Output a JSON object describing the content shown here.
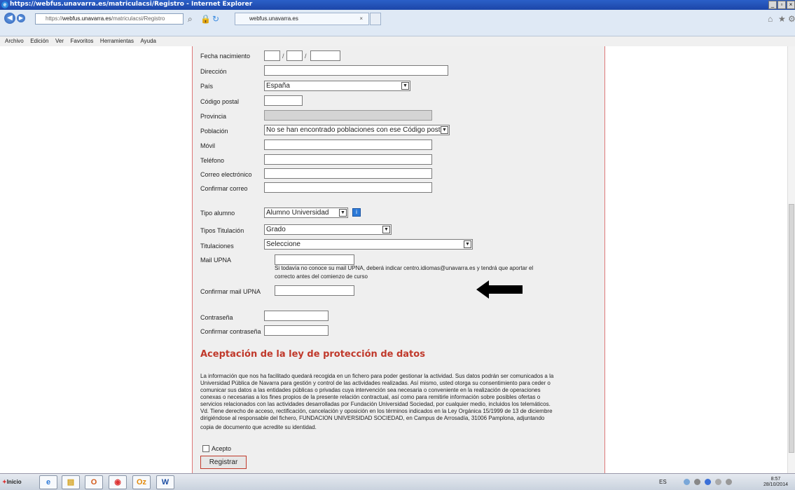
{
  "window": {
    "title": "https://webfus.unavarra.es/matriculacsi/Registro - Internet Explorer",
    "ie_icon": "e"
  },
  "nav": {
    "address_prefix": "https://",
    "address_domain": "webfus.unavarra.es",
    "address_path": "/matriculacsi/Registro",
    "tab_label": "webfus.unavarra.es",
    "tab_close": "×"
  },
  "menu": {
    "items": [
      "Archivo",
      "Edición",
      "Ver",
      "Favoritos",
      "Herramientas",
      "Ayuda"
    ]
  },
  "form": {
    "fecha_nacimiento": "Fecha nacimiento",
    "date_sep": "/",
    "direccion": "Dirección",
    "pais": "País",
    "pais_value": "España",
    "codigo_postal": "Código postal",
    "provincia": "Provincia",
    "poblacion": "Población",
    "poblacion_value": "No se han encontrado poblaciones con ese Código postal",
    "movil": "Móvil",
    "telefono": "Teléfono",
    "correo": "Correo electrónico",
    "confirmar_correo": "Confirmar correo",
    "tipo_alumno": "Tipo alumno",
    "tipo_alumno_value": "Alumno Universidad",
    "tipos_titulacion": "Tipos Titulación",
    "tipos_titulacion_value": "Grado",
    "titulaciones": "Titulaciones",
    "titulaciones_value": "Seleccione",
    "mail_upna": "Mail UPNA",
    "mail_note_1": "Si todavía no conoce su mail UPNA, deberá indicar centro.idiomas@unavarra.es y tendrá que aportar el",
    "mail_note_2": "correcto antes del comienzo de curso",
    "confirmar_mail": "Confirmar mail UPNA",
    "contrasena": "Contraseña",
    "confirmar_contrasena": "Confirmar contraseña"
  },
  "privacy": {
    "title": "Aceptación de la ley de protección de datos",
    "lines": [
      "La información que nos ha facilitado quedará recogida en un fichero para poder gestionar la actividad. Sus datos podrán ser comunicados a la",
      "Universidad Pública de Navarra para gestión y control de las actividades realizadas. Así mismo, usted otorga su consentimiento para ceder o",
      "comunicar sus datos a las entidades públicas o privadas cuya intervención sea necesaria o conveniente en la realización de operaciones",
      "conexas o necesarias a los fines propios de la presente relación contractual, así como para remitirle información sobre posibles ofertas o",
      "servicios relacionados con las actividades desarrolladas por Fundación Universidad Sociedad, por cualquier medio, incluidos los telemáticos.",
      "Vd. Tiene derecho de acceso, rectificación, cancelación y oposición en los términos indicados en la Ley Orgánica 15/1999 de 13 de diciembre",
      "dirigiéndose al responsable del fichero, FUNDACION UNIVERSIDAD SOCIEDAD, en Campus de Arrosadía, 31006 Pamplona, adjuntando",
      "copia de documento que acredite su identidad."
    ],
    "accept_label": "Acepto",
    "register_label": "Registrar"
  },
  "taskbar": {
    "start_label": "Inicio",
    "apps": [
      "e",
      "▤",
      "O",
      "◉",
      "Oz",
      "W"
    ],
    "lang": "ES",
    "time": "8:57",
    "date": "28/10/2014"
  },
  "colors": {
    "accent_red": "#c0392b",
    "title_blue": "#2b60c8"
  }
}
